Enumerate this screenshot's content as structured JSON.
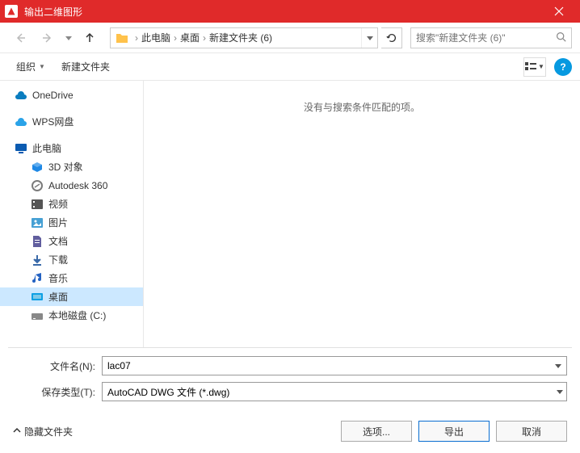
{
  "title": "输出二维图形",
  "breadcrumb": {
    "pc": "此电脑",
    "desktop": "桌面",
    "folder": "新建文件夹 (6)"
  },
  "search": {
    "placeholder": "搜索\"新建文件夹 (6)\""
  },
  "toolbar": {
    "organize": "组织",
    "newfolder": "新建文件夹"
  },
  "tree": {
    "onedrive": "OneDrive",
    "wps": "WPS网盘",
    "thispc": "此电脑",
    "obj3d": "3D 对象",
    "autodesk": "Autodesk 360",
    "video": "视频",
    "pictures": "图片",
    "documents": "文档",
    "downloads": "下载",
    "music": "音乐",
    "desktop": "桌面",
    "localdisk": "本地磁盘 (C:)"
  },
  "empty_msg": "没有与搜索条件匹配的项。",
  "form": {
    "filename_label": "文件名(N):",
    "filename_value": "lac07",
    "filetype_label": "保存类型(T):",
    "filetype_value": "AutoCAD DWG 文件 (*.dwg)"
  },
  "footer": {
    "hide_folders": "隐藏文件夹",
    "options": "选项...",
    "export": "导出",
    "cancel": "取消"
  }
}
